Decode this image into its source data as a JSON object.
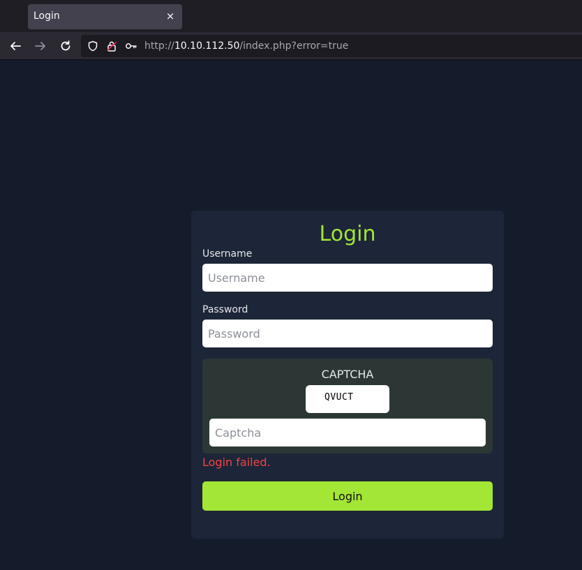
{
  "browser": {
    "tab_title": "Login",
    "tab_close": "×",
    "url_scheme": "http://",
    "url_host": "10.10.112.50",
    "url_path": "/index.php?error=true"
  },
  "login": {
    "title": "Login",
    "username_label": "Username",
    "username_placeholder": "Username",
    "password_label": "Password",
    "password_placeholder": "Password",
    "captcha_title": "CAPTCHA",
    "captcha_code": "QVUCT",
    "captcha_placeholder": "Captcha",
    "error": "Login failed.",
    "button": "Login"
  },
  "colors": {
    "page_bg": "#141b2b",
    "card_bg": "#1d2538",
    "accent": "#a3e635",
    "error": "#ef4444",
    "captcha_bg": "#2c3735"
  },
  "icons": [
    "close-icon",
    "back-arrow-icon",
    "forward-arrow-icon",
    "reload-icon",
    "shield-icon",
    "insecure-lock-icon",
    "key-icon"
  ]
}
